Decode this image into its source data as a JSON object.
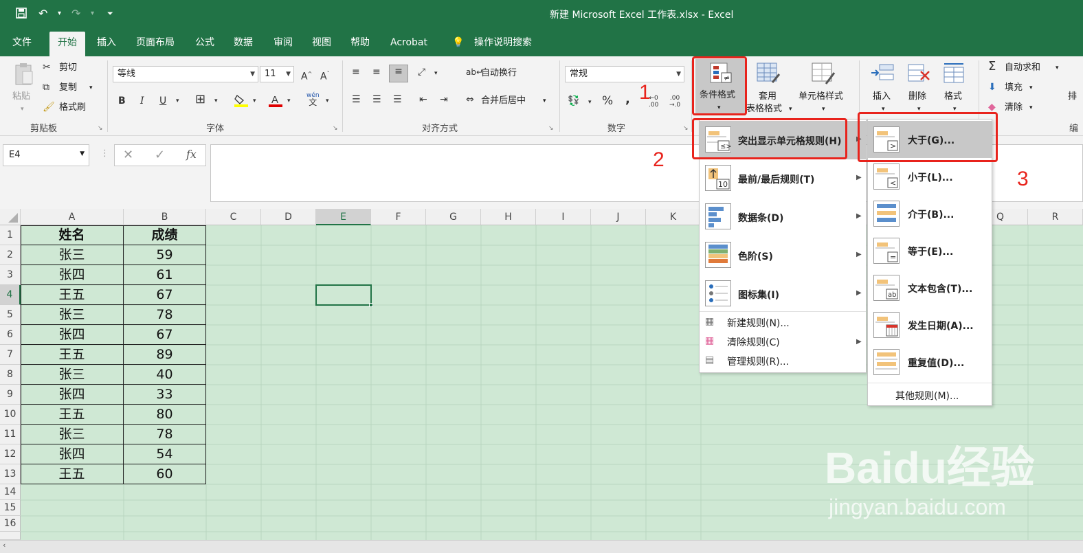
{
  "window": {
    "title": "新建 Microsoft Excel 工作表.xlsx  -  Excel"
  },
  "quick_access": {
    "save_icon": "save-icon",
    "undo_icon": "undo-icon",
    "redo_icon": "redo-icon"
  },
  "tabs": [
    {
      "label": "文件"
    },
    {
      "label": "开始"
    },
    {
      "label": "插入"
    },
    {
      "label": "页面布局"
    },
    {
      "label": "公式"
    },
    {
      "label": "数据"
    },
    {
      "label": "审阅"
    },
    {
      "label": "视图"
    },
    {
      "label": "帮助"
    },
    {
      "label": "Acrobat"
    },
    {
      "label": "操作说明搜索"
    }
  ],
  "ribbon": {
    "clipboard": {
      "paste": "粘贴",
      "cut": "剪切",
      "copy": "复制",
      "format_painter": "格式刷",
      "group": "剪贴板"
    },
    "font": {
      "name": "等线",
      "size": "11",
      "bold": "B",
      "italic": "I",
      "underline": "U",
      "group": "字体"
    },
    "align": {
      "wrap": "自动换行",
      "merge": "合并后居中",
      "group": "对齐方式"
    },
    "number": {
      "format": "常规",
      "percent": "%",
      "comma": ",",
      "group": "数字"
    },
    "styles": {
      "conditional": "条件格式",
      "table1": "套用",
      "table2": "表格格式",
      "cell_style": "单元格样式"
    },
    "cells": {
      "insert": "插入",
      "delete": "删除",
      "format": "格式"
    },
    "edit": {
      "autosum": "自动求和",
      "fill": "填充",
      "clear": "清除",
      "sort": "排",
      "group": "编"
    }
  },
  "annotations": {
    "n1": "1",
    "n2": "2",
    "n3": "3"
  },
  "formula_bar": {
    "name_box": "E4",
    "fx": "fx"
  },
  "columns": [
    "A",
    "B",
    "C",
    "D",
    "E",
    "F",
    "G",
    "H",
    "I",
    "J",
    "K",
    "Q",
    "R"
  ],
  "rows": [
    "1",
    "2",
    "3",
    "4",
    "5",
    "6",
    "7",
    "8",
    "9",
    "10",
    "11",
    "12",
    "13",
    "14",
    "15",
    "16"
  ],
  "table": {
    "headers": [
      "姓名",
      "成绩"
    ],
    "rows": [
      [
        "张三",
        "59"
      ],
      [
        "张四",
        "61"
      ],
      [
        "王五",
        "67"
      ],
      [
        "张三",
        "78"
      ],
      [
        "张四",
        "67"
      ],
      [
        "王五",
        "89"
      ],
      [
        "张三",
        "40"
      ],
      [
        "张四",
        "33"
      ],
      [
        "王五",
        "80"
      ],
      [
        "张三",
        "78"
      ],
      [
        "张四",
        "54"
      ],
      [
        "王五",
        "60"
      ]
    ]
  },
  "cf_menu": {
    "items": [
      {
        "label": "突出显示单元格规则(H)"
      },
      {
        "label": "最前/最后规则(T)"
      },
      {
        "label": "数据条(D)"
      },
      {
        "label": "色阶(S)"
      },
      {
        "label": "图标集(I)"
      }
    ],
    "small_items": [
      {
        "label": "新建规则(N)..."
      },
      {
        "label": "清除规则(C)"
      },
      {
        "label": "管理规则(R)..."
      }
    ]
  },
  "sub_menu": {
    "items": [
      {
        "label": "大于(G)..."
      },
      {
        "label": "小于(L)..."
      },
      {
        "label": "介于(B)..."
      },
      {
        "label": "等于(E)..."
      },
      {
        "label": "文本包含(T)..."
      },
      {
        "label": "发生日期(A)..."
      },
      {
        "label": "重复值(D)..."
      }
    ],
    "more": "其他规则(M)..."
  },
  "watermark": {
    "brand": "Baidu经验",
    "url": "jingyan.baidu.com"
  },
  "colors": {
    "excel_green": "#217346",
    "grid_bg": "#cfe8d4",
    "highlight_red": "#e8231c"
  }
}
